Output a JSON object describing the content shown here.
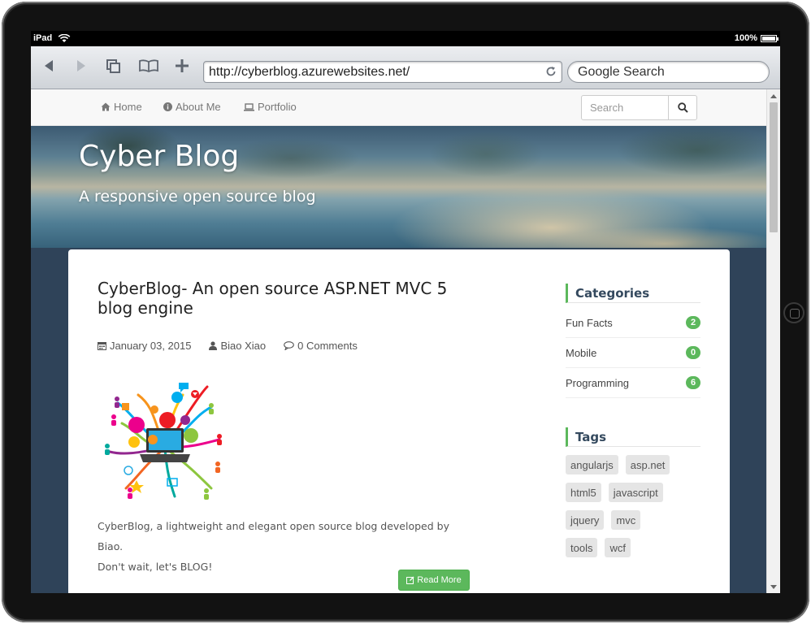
{
  "status_bar": {
    "device": "iPad",
    "battery": "100%"
  },
  "browser": {
    "url": "http://cyberblog.azurewebsites.net/",
    "search_placeholder": "Google Search",
    "buttons": [
      "back-icon",
      "forward-icon",
      "tabs-icon",
      "bookmarks-icon",
      "add-icon"
    ]
  },
  "navbar": {
    "links": [
      {
        "label": "Home",
        "icon": "home-icon"
      },
      {
        "label": "About Me",
        "icon": "info-icon"
      },
      {
        "label": "Portfolio",
        "icon": "laptop-icon"
      }
    ],
    "search_placeholder": "Search"
  },
  "hero": {
    "title": "Cyber Blog",
    "subtitle": "A responsive open source blog"
  },
  "post": {
    "title": "CyberBlog- An open source ASP.NET MVC 5 blog engine",
    "date": "January 03, 2015",
    "author": "Biao Xiao",
    "comments": "0 Comments",
    "excerpt_line1": "CyberBlog, a lightweight and elegant open source blog developed by Biao.",
    "excerpt_line2": "Don't wait, let's BLOG!",
    "read_more": "Read More"
  },
  "sidebar": {
    "categories_title": "Categories",
    "categories": [
      {
        "name": "Fun Facts",
        "count": "2"
      },
      {
        "name": "Mobile",
        "count": "0"
      },
      {
        "name": "Programming",
        "count": "6"
      }
    ],
    "tags_title": "Tags",
    "tags": [
      [
        "angularjs",
        "asp.net"
      ],
      [
        "html5",
        "javascript"
      ],
      [
        "jquery",
        "mvc"
      ],
      [
        "tools",
        "wcf"
      ]
    ]
  },
  "colors": {
    "accent_green": "#5cb85c",
    "page_background": "#2f4359",
    "heading": "#34495e"
  }
}
